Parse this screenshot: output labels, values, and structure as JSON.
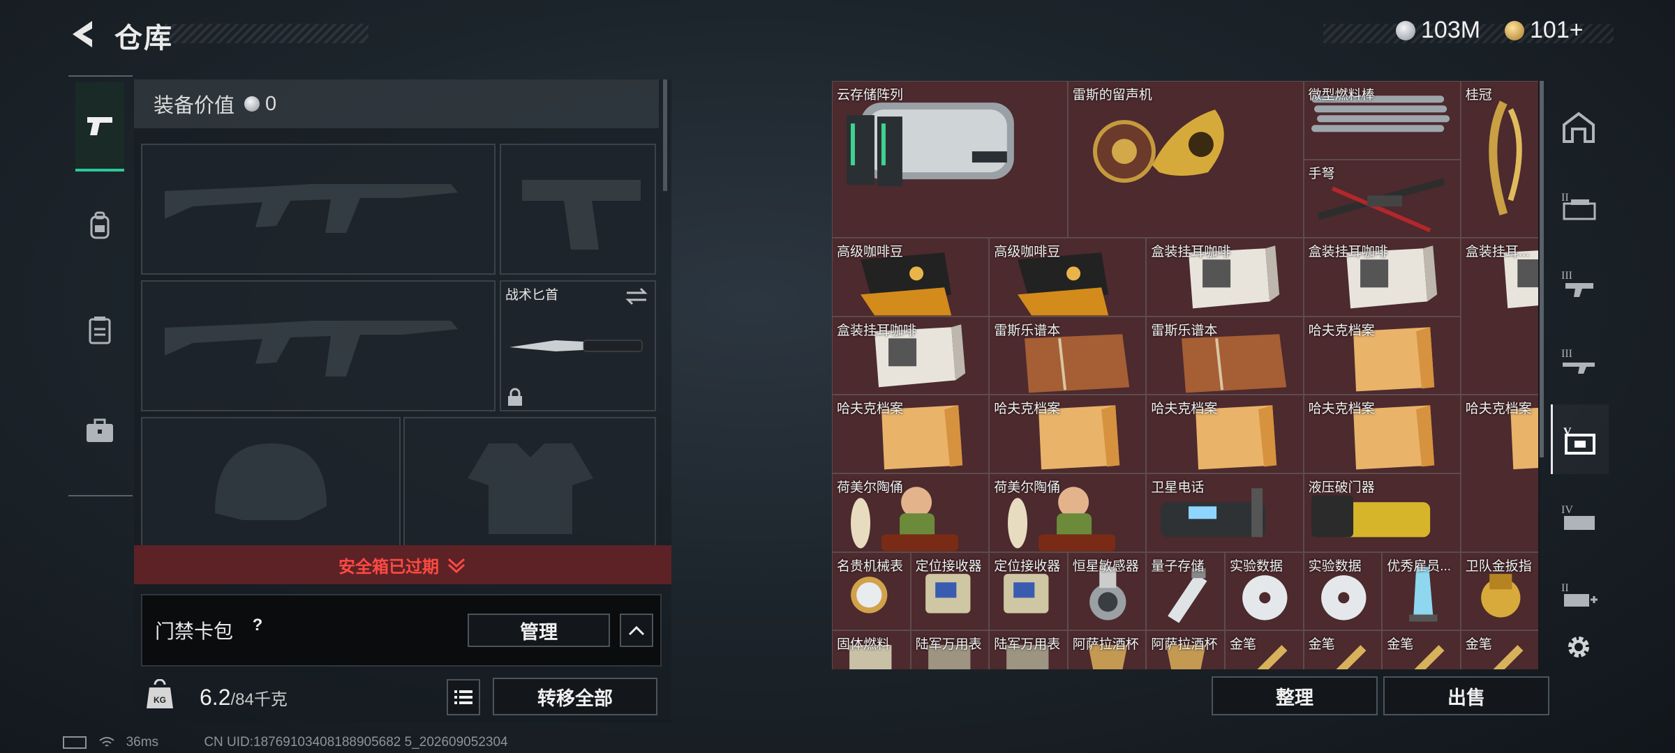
{
  "header": {
    "title": "仓库",
    "currency_silver": "103M",
    "currency_gold": "101+",
    "colors": {
      "silver": "#c8ccd0",
      "gold": "#d2a84a"
    }
  },
  "left_nav": {
    "items": [
      {
        "icon": "pistol-icon",
        "active": true
      },
      {
        "icon": "backpack-icon"
      },
      {
        "icon": "vest-icon"
      },
      {
        "icon": "briefcase-icon"
      }
    ],
    "accent": "#2fc79a"
  },
  "equipment": {
    "value_label": "装备价值",
    "value": "0",
    "slots": [
      {
        "name": "primary-weapon"
      },
      {
        "name": "pistol"
      },
      {
        "name": "secondary-weapon"
      },
      {
        "name": "melee",
        "label": "战术匕首"
      },
      {
        "name": "helmet"
      },
      {
        "name": "armor"
      }
    ],
    "safebox_label": "安全箱已过期",
    "keycard_label": "门禁卡包",
    "help": "?",
    "manage_label": "管理",
    "weight_current": "6.2",
    "weight_max": "/84千克",
    "transfer_label": "转移全部",
    "colors": {
      "warning": "#ff4a42",
      "warning_bg": "#5c2226"
    }
  },
  "inventory": {
    "items": [
      {
        "label": "云存储阵列",
        "icon": "server-icon"
      },
      {
        "label": "雷斯的留声机",
        "icon": "gramophone-icon"
      },
      {
        "label": "微型燃料棒",
        "icon": "fuel-rod-icon"
      },
      {
        "label": "桂冠",
        "icon": "laurel-icon"
      },
      {
        "label": "手弩",
        "icon": "crossbow-icon"
      },
      {
        "label": "高级咖啡豆",
        "icon": "coffee-beans-icon"
      },
      {
        "label": "高级咖啡豆",
        "icon": "coffee-beans-icon"
      },
      {
        "label": "盒装挂耳咖啡",
        "icon": "coffee-box-icon"
      },
      {
        "label": "盒装挂耳咖啡",
        "icon": "coffee-box-icon"
      },
      {
        "label": "盒装挂耳...",
        "icon": "coffee-box-icon"
      },
      {
        "label": "盒装挂耳咖啡",
        "icon": "coffee-box-icon"
      },
      {
        "label": "雷斯乐谱本",
        "icon": "notebook-icon"
      },
      {
        "label": "雷斯乐谱本",
        "icon": "notebook-icon"
      },
      {
        "label": "哈夫克档案",
        "icon": "folder-icon"
      },
      {
        "label": "哈夫克档案",
        "icon": "folder-icon"
      },
      {
        "label": "哈夫克档案",
        "icon": "folder-icon"
      },
      {
        "label": "哈夫克档案",
        "icon": "folder-icon"
      },
      {
        "label": "哈夫克档案",
        "icon": "folder-icon"
      },
      {
        "label": "哈夫克档案",
        "icon": "folder-icon"
      },
      {
        "label": "荷美尔陶俑",
        "icon": "figurine-icon"
      },
      {
        "label": "荷美尔陶俑",
        "icon": "figurine-icon"
      },
      {
        "label": "卫星电话",
        "icon": "satphone-icon"
      },
      {
        "label": "液压破门器",
        "icon": "breacher-icon"
      },
      {
        "label": "名贵机械表",
        "icon": "watch-icon"
      },
      {
        "label": "定位接收器",
        "icon": "receiver-icon"
      },
      {
        "label": "定位接收器",
        "icon": "receiver-icon"
      },
      {
        "label": "恒星敏感器",
        "icon": "sensor-icon"
      },
      {
        "label": "量子存储",
        "icon": "usb-icon"
      },
      {
        "label": "实验数据",
        "icon": "disc-icon"
      },
      {
        "label": "实验数据",
        "icon": "disc-icon"
      },
      {
        "label": "优秀雇员...",
        "icon": "trophy-icon"
      },
      {
        "label": "卫队金扳指",
        "icon": "ring-icon"
      },
      {
        "label": "固体燃料",
        "icon": "fuel-icon"
      },
      {
        "label": "陆军万用表",
        "icon": "multimeter-icon"
      },
      {
        "label": "陆军万用表",
        "icon": "multimeter-icon"
      },
      {
        "label": "阿萨拉酒杯",
        "icon": "cup-icon"
      },
      {
        "label": "阿萨拉酒杯",
        "icon": "cup-icon"
      },
      {
        "label": "金笔",
        "icon": "pen-icon"
      },
      {
        "label": "金笔",
        "icon": "pen-icon"
      },
      {
        "label": "金笔",
        "icon": "pen-icon"
      },
      {
        "label": "金笔",
        "icon": "pen-icon"
      }
    ],
    "sort_label": "整理",
    "sell_label": "出售",
    "colors": {
      "cell_bg": "#4c2a2e"
    }
  },
  "right_nav": {
    "items": [
      {
        "icon": "home-tab-icon"
      },
      {
        "icon": "tab-2-icon",
        "roman": "II"
      },
      {
        "icon": "tab-3a-icon",
        "roman": "III"
      },
      {
        "icon": "tab-3b-icon",
        "roman": "III"
      },
      {
        "icon": "tab-5-icon",
        "roman": "V",
        "active": true
      },
      {
        "icon": "tab-4-icon",
        "roman": "IV"
      },
      {
        "icon": "tab-add-icon",
        "roman": "II"
      }
    ],
    "settings_icon": "gear-icon"
  },
  "status": {
    "ping": "36ms",
    "uid": "CN UID:18769103408188905682 5_202609052304"
  }
}
